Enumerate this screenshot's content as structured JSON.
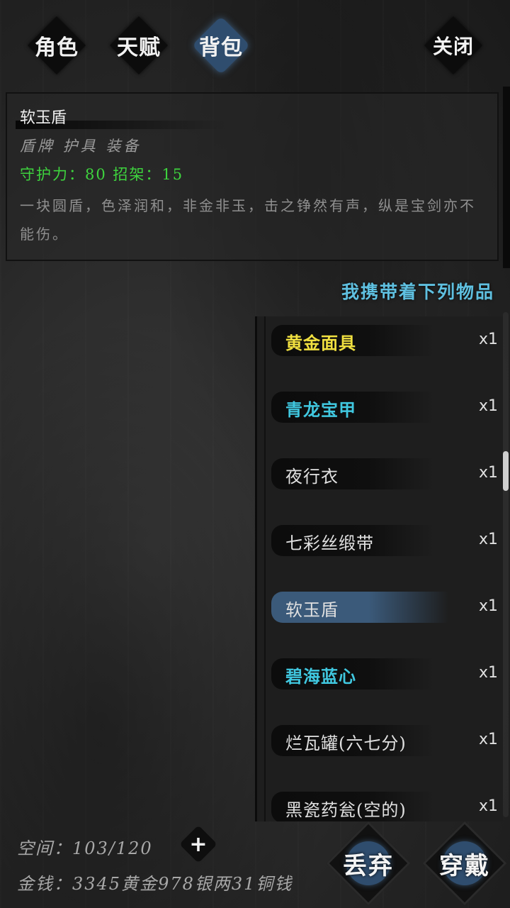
{
  "tabs": [
    {
      "label": "角色",
      "active": false
    },
    {
      "label": "天赋",
      "active": false
    },
    {
      "label": "背包",
      "active": true
    }
  ],
  "close_label": "关闭",
  "selected_item": {
    "name": "软玉盾",
    "type": "盾牌 护具 装备",
    "stats": "守护力：80 招架：15",
    "description": "一块圆盾，色泽润和，非金非玉，击之铮然有声，纵是宝剑亦不能伤。"
  },
  "inventory": {
    "title": "我携带着下列物品",
    "items": [
      {
        "name": "黄金面具",
        "qty": "x1",
        "color": "#f0e040"
      },
      {
        "name": "青龙宝甲",
        "qty": "x1",
        "color": "#40c8e0"
      },
      {
        "name": "夜行衣",
        "qty": "x1",
        "color": "#e0e0e0"
      },
      {
        "name": "七彩丝缎带",
        "qty": "x1",
        "color": "#e0e0e0"
      },
      {
        "name": "软玉盾",
        "qty": "x1",
        "color": "#e0e0e0",
        "selected": true
      },
      {
        "name": "碧海蓝心",
        "qty": "x1",
        "color": "#40c8e0"
      },
      {
        "name": "烂瓦罐(六七分)",
        "qty": "x1",
        "color": "#e0e0e0"
      },
      {
        "name": "黑瓷药瓮(空的)",
        "qty": "x1",
        "color": "#e0e0e0"
      }
    ]
  },
  "footer": {
    "space": "空间：103/120",
    "money": "金钱：3345黄金978银两31铜钱",
    "plus_label": "+",
    "discard_label": "丢弃",
    "equip_label": "穿戴"
  },
  "colors": {
    "accent_blue": "#2f4d6e",
    "title_cyan": "#5fc0e0",
    "stat_green": "#3ed43e"
  }
}
